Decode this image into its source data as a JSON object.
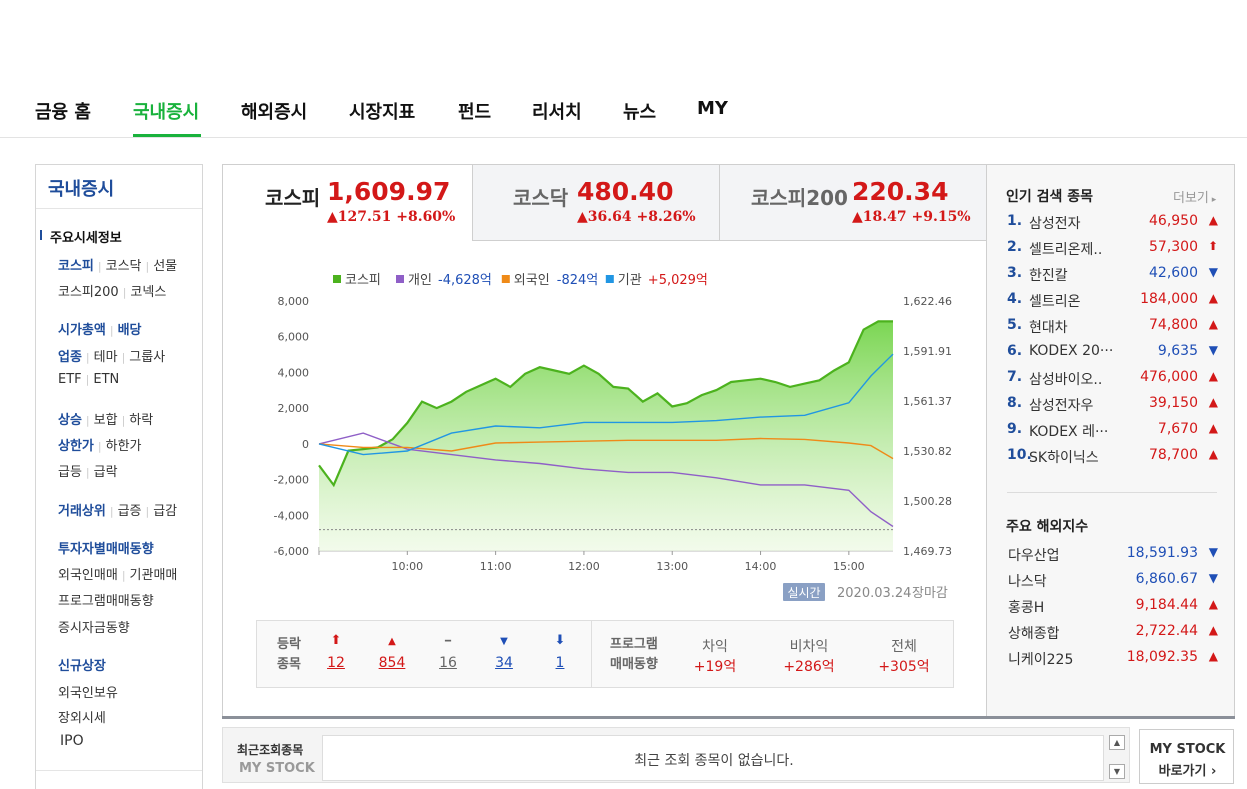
{
  "topnav": {
    "items": [
      "금융 홈",
      "국내증시",
      "해외증시",
      "시장지표",
      "펀드",
      "리서치",
      "뉴스",
      "MY"
    ],
    "active": "국내증시"
  },
  "sidebar": {
    "title": "국내증시",
    "section": "주요시세정보",
    "rows": [
      [
        "코스피",
        "코스닥",
        "선물"
      ],
      [
        "코스피200",
        "코넥스"
      ],
      [
        "시가총액",
        "배당"
      ],
      [
        "업종",
        "테마",
        "그룹사"
      ],
      [
        "ETF",
        "ETN"
      ],
      [
        "상승",
        "보합",
        "하락"
      ],
      [
        "상한가",
        "하한가"
      ],
      [
        "급등",
        "급락"
      ],
      [
        "거래상위",
        "급증",
        "급감"
      ],
      [
        "투자자별매매동향"
      ],
      [
        "외국인매매",
        "기관매매"
      ],
      [
        "프로그램매매동향"
      ],
      [
        "증시자금동향"
      ],
      [
        "신규상장"
      ],
      [
        "외국인보유"
      ],
      [
        "장외시세"
      ],
      [
        "IPO"
      ]
    ]
  },
  "tabs": [
    {
      "name": "코스피",
      "value": "1,609.97",
      "change": "▲127.51 +8.60%"
    },
    {
      "name": "코스닥",
      "value": "480.40",
      "change": "▲36.64 +8.26%"
    },
    {
      "name": "코스피200",
      "value": "220.34",
      "change": "▲18.47 +9.15%"
    }
  ],
  "legend": [
    {
      "label": "코스피",
      "value": "",
      "color": "#4cb21e"
    },
    {
      "label": "개인",
      "value": "-4,628억",
      "color": "#8f5fc7",
      "value_color": "#1f4fb6"
    },
    {
      "label": "외국인",
      "value": "-824억",
      "color": "#ef8a18",
      "value_color": "#1f4fb6"
    },
    {
      "label": "기관",
      "value": "+5,029억",
      "color": "#2196e3",
      "value_color": "#d31818"
    }
  ],
  "chart_data": {
    "type": "line",
    "title": "",
    "xlabel": "",
    "ylabel": "",
    "x_ticks": [
      "10:00",
      "11:00",
      "12:00",
      "13:00",
      "14:00",
      "15:00"
    ],
    "y_left_ticks": [
      "8,000",
      "6,000",
      "4,000",
      "2,000",
      "0",
      "-2,000",
      "-4,000",
      "-6,000"
    ],
    "y_right_ticks": [
      "1,622.46",
      "1,591.91",
      "1,561.37",
      "1,530.82",
      "1,500.28",
      "1,469.73"
    ],
    "ylim_left": [
      -6000,
      8000
    ],
    "ylim_right": [
      1469.73,
      1622.46
    ],
    "x_range": [
      "09:00",
      "15:30"
    ],
    "baseline_left": -4800,
    "series": [
      {
        "name": "코스피",
        "axis": "right",
        "color": "#4cb21e",
        "fill": true,
        "x": [
          "09:00",
          "09:10",
          "09:20",
          "09:30",
          "09:40",
          "09:50",
          "10:00",
          "10:10",
          "10:20",
          "10:30",
          "10:40",
          "10:50",
          "11:00",
          "11:10",
          "11:20",
          "11:30",
          "11:40",
          "11:50",
          "12:00",
          "12:10",
          "12:20",
          "12:30",
          "12:40",
          "12:50",
          "13:00",
          "13:10",
          "13:20",
          "13:30",
          "13:40",
          "13:50",
          "14:00",
          "14:10",
          "14:20",
          "14:30",
          "14:40",
          "14:50",
          "15:00",
          "15:10",
          "15:20",
          "15:30"
        ],
        "values": [
          1522,
          1510,
          1531,
          1532,
          1533,
          1538,
          1548,
          1561,
          1557,
          1561,
          1567,
          1571,
          1575,
          1570,
          1578,
          1582,
          1580,
          1578,
          1583,
          1578,
          1570,
          1569,
          1561,
          1566,
          1558,
          1560,
          1565,
          1568,
          1573,
          1574,
          1575,
          1573,
          1570,
          1572,
          1574,
          1580,
          1585,
          1605,
          1610,
          1610
        ]
      },
      {
        "name": "개인",
        "axis": "left",
        "color": "#8f5fc7",
        "x": [
          "09:00",
          "09:30",
          "10:00",
          "10:30",
          "11:00",
          "11:30",
          "12:00",
          "12:30",
          "13:00",
          "13:30",
          "14:00",
          "14:30",
          "15:00",
          "15:15",
          "15:30"
        ],
        "values": [
          0,
          600,
          -300,
          -600,
          -900,
          -1100,
          -1400,
          -1600,
          -1600,
          -1900,
          -2300,
          -2300,
          -2600,
          -3800,
          -4628
        ]
      },
      {
        "name": "외국인",
        "axis": "left",
        "color": "#ef8a18",
        "x": [
          "09:00",
          "09:30",
          "10:00",
          "10:30",
          "11:00",
          "11:30",
          "12:00",
          "12:30",
          "13:00",
          "13:30",
          "14:00",
          "14:30",
          "15:00",
          "15:15",
          "15:30"
        ],
        "values": [
          0,
          -200,
          -200,
          -400,
          50,
          100,
          150,
          200,
          200,
          200,
          300,
          250,
          50,
          -100,
          -824
        ]
      },
      {
        "name": "기관",
        "axis": "left",
        "color": "#2196e3",
        "x": [
          "09:00",
          "09:30",
          "10:00",
          "10:30",
          "11:00",
          "11:30",
          "12:00",
          "12:30",
          "13:00",
          "13:30",
          "14:00",
          "14:30",
          "15:00",
          "15:15",
          "15:30"
        ],
        "values": [
          0,
          -600,
          -400,
          600,
          1000,
          900,
          1200,
          1200,
          1200,
          1300,
          1500,
          1600,
          2300,
          3800,
          5029
        ]
      }
    ]
  },
  "chart_footer": {
    "realtime": "실시간",
    "date": "2020.03.24",
    "status": "장마감"
  },
  "stats": {
    "label_line1": "등락",
    "label_line2": "종목",
    "items": [
      {
        "symbol": "⬆",
        "count": "12",
        "color": "#d31818"
      },
      {
        "symbol": "▲",
        "count": "854",
        "color": "#d31818"
      },
      {
        "symbol": "━",
        "count": "16",
        "color": "#666"
      },
      {
        "symbol": "▼",
        "count": "34",
        "color": "#1f4fb6"
      },
      {
        "symbol": "⬇",
        "count": "1",
        "color": "#1f4fb6"
      }
    ],
    "program_line1": "프로그램",
    "program_line2": "매매동향",
    "program": [
      {
        "label": "차익",
        "value": "+19억"
      },
      {
        "label": "비차익",
        "value": "+286억"
      },
      {
        "label": "전체",
        "value": "+305억"
      }
    ]
  },
  "popular": {
    "title": "인기 검색 종목",
    "more": "더보기",
    "items": [
      {
        "rank": "1.",
        "name": "삼성전자",
        "price": "46,950",
        "dir": "up"
      },
      {
        "rank": "2.",
        "name": "셀트리온제..",
        "price": "57,300",
        "dir": "upper"
      },
      {
        "rank": "3.",
        "name": "한진칼",
        "price": "42,600",
        "dir": "down"
      },
      {
        "rank": "4.",
        "name": "셀트리온",
        "price": "184,000",
        "dir": "up"
      },
      {
        "rank": "5.",
        "name": "현대차",
        "price": "74,800",
        "dir": "up"
      },
      {
        "rank": "6.",
        "name": "KODEX 20···",
        "price": "9,635",
        "dir": "down"
      },
      {
        "rank": "7.",
        "name": "삼성바이오..",
        "price": "476,000",
        "dir": "up"
      },
      {
        "rank": "8.",
        "name": "삼성전자우",
        "price": "39,150",
        "dir": "up"
      },
      {
        "rank": "9.",
        "name": "KODEX 레···",
        "price": "7,670",
        "dir": "up"
      },
      {
        "rank": "10.",
        "name": "SK하이닉스",
        "price": "78,700",
        "dir": "up"
      }
    ]
  },
  "world": {
    "title": "주요 해외지수",
    "items": [
      {
        "name": "다우산업",
        "price": "18,591.93",
        "dir": "down"
      },
      {
        "name": "나스닥",
        "price": "6,860.67",
        "dir": "down"
      },
      {
        "name": "홍콩H",
        "price": "9,184.44",
        "dir": "up"
      },
      {
        "name": "상해종합",
        "price": "2,722.44",
        "dir": "up"
      },
      {
        "name": "니케이225",
        "price": "18,092.35",
        "dir": "up"
      }
    ]
  },
  "recent": {
    "label1": "최근조회종목",
    "label2": "MY STOCK",
    "message": "최근 조회 종목이 없습니다."
  },
  "mystock_button": {
    "line1": "MY STOCK",
    "line2": "바로가기 ›"
  },
  "colors": {
    "accent": "#19b23c",
    "up": "#d31818",
    "down": "#1f4fb6",
    "navy": "#1f4d9b"
  }
}
